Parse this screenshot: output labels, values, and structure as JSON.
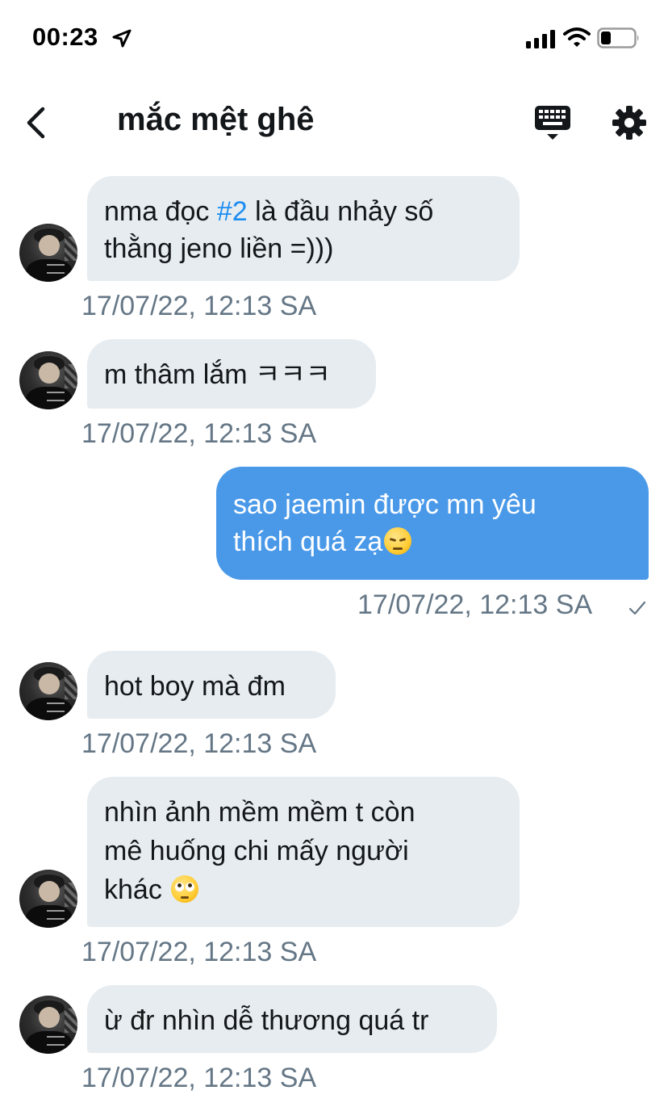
{
  "status_bar": {
    "time": "00:23"
  },
  "header": {
    "title": "mắc mệt ghê"
  },
  "icons": {
    "back": "chevron-left-icon",
    "keyboard": "keyboard-icon",
    "settings": "gear-icon",
    "location": "location-arrow-icon",
    "signal": "cellular-signal-icon",
    "wifi": "wifi-icon",
    "battery": "battery-icon",
    "read_receipt": "checkmark-icon"
  },
  "colors": {
    "incoming_bubble": "#e6ecf0",
    "outgoing_bubble": "#4a99e9",
    "hashtag": "#1d8cf0",
    "timestamp": "#657786"
  },
  "messages": [
    {
      "direction": "incoming",
      "line1_prefix": "nma đọc ",
      "hashtag": "#2",
      "line1_suffix": " là đầu nhảy số",
      "line2": "thằng jeno liền =)))",
      "time": "17/07/22, 12:13 SA"
    },
    {
      "direction": "incoming",
      "text": "m thâm lắm ㅋㅋㅋ",
      "time": "17/07/22, 12:13 SA"
    },
    {
      "direction": "outgoing",
      "line1": "sao jaemin được mn yêu",
      "line2": "thích quá zạ",
      "emoji": "pensive-face-emoji",
      "time": "17/07/22, 12:13 SA"
    },
    {
      "direction": "incoming",
      "text": "hot boy mà đm",
      "time": "17/07/22, 12:13 SA"
    },
    {
      "direction": "incoming",
      "line1": "nhìn ảnh mềm mềm t còn",
      "line2": "mê huống chi mấy người",
      "line3": "khác",
      "emoji": "face-with-rolling-eyes-emoji",
      "time": "17/07/22, 12:13 SA"
    },
    {
      "direction": "incoming",
      "text": "ừ đr nhìn dễ thương quá tr",
      "time": "17/07/22, 12:13 SA"
    }
  ]
}
